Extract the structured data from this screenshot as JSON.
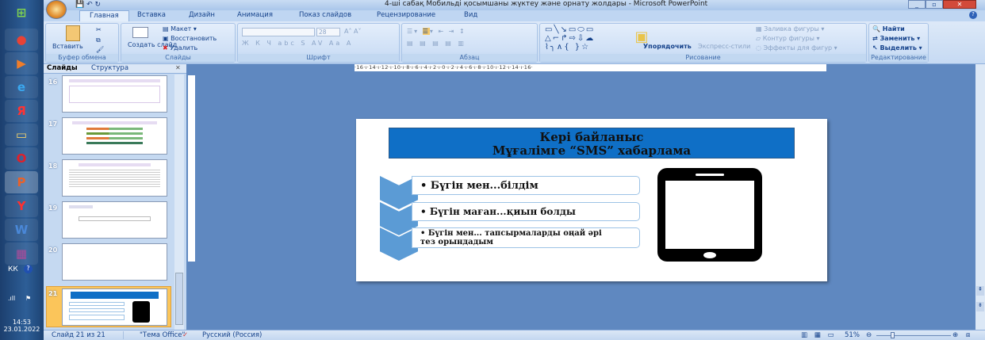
{
  "window": {
    "title": "4-ші сабақ Мобильді қосымшаны жүктеу және орнату жолдары - Microsoft PowerPoint"
  },
  "taskbar": {
    "lang": "КК",
    "time": "14:53",
    "date": "23.01.2022",
    "apps": [
      "chrome",
      "media-player",
      "internet-explorer",
      "yandex-browser",
      "file-explorer",
      "opera",
      "powerpoint",
      "yandex",
      "word",
      "winrar"
    ]
  },
  "tabs": [
    "Главная",
    "Вставка",
    "Дизайн",
    "Анимация",
    "Показ слайдов",
    "Рецензирование",
    "Вид"
  ],
  "ribbon": {
    "clipboard": {
      "label": "Буфер обмена",
      "paste": "Вставить"
    },
    "slides": {
      "label": "Слайды",
      "new_slide": "Создать слайд",
      "layout": "Макет",
      "reset": "Восстановить",
      "delete": "Удалить"
    },
    "font": {
      "label": "Шрифт",
      "size": "28"
    },
    "paragraph": {
      "label": "Абзац"
    },
    "drawing": {
      "label": "Рисование",
      "arrange": "Упорядочить",
      "quick_styles": "Экспресс-стили",
      "fill": "Заливка фигуры",
      "outline": "Контур фигуры",
      "effects": "Эффекты для фигур"
    },
    "editing": {
      "label": "Редактирование",
      "find": "Найти",
      "replace": "Заменить",
      "select": "Выделить"
    }
  },
  "pane": {
    "tab_slides": "Слайды",
    "tab_outline": "Структура",
    "thumbnails": [
      "16",
      "17",
      "18",
      "19",
      "20",
      "21"
    ],
    "selected": "21"
  },
  "ruler": "·16·ı·14·ı·12·ı·10·ı·8·ı·6·ı·4·ı·2·ı·0·ı·2·ı·4·ı·6·ı·8·ı·10·ı·12·ı·14·ı·16·",
  "slide": {
    "title_line1": "Кері байланыс",
    "title_line2": "Мұғалімге “SMS” хабарлама",
    "items": [
      "• Бүгін мен...білдім",
      "• Бүгін маған...қиын болды",
      "• Бүгін мен... тапсырмаларды оңай әрі тез орындадым"
    ]
  },
  "status": {
    "slide": "Слайд 21 из 21",
    "theme": "\"Тема Office\"",
    "language": "Русский (Россия)",
    "zoom": "51%",
    "zoom_value": 51
  },
  "colors": {
    "title_fill": "#0f6fc6",
    "chevron": "#5b9bd5",
    "workspace": "#5f88c0"
  }
}
